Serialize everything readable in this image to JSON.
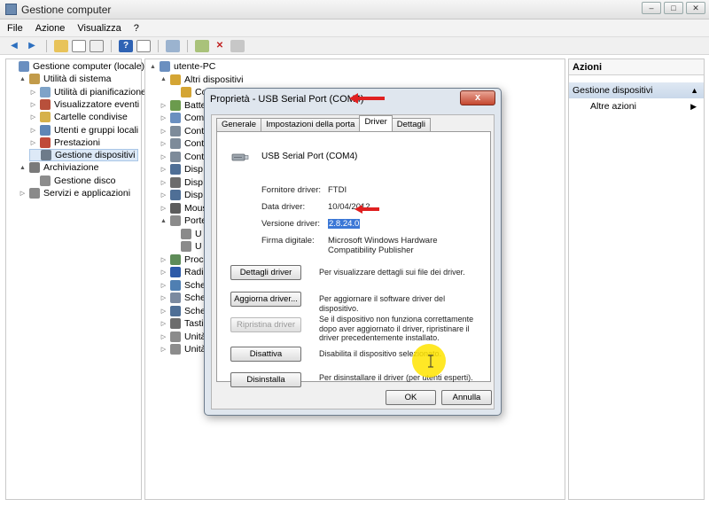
{
  "window": {
    "title": "Gestione computer",
    "controls": [
      "–",
      "□",
      "✕"
    ]
  },
  "menu": [
    "File",
    "Azione",
    "Visualizza",
    "?"
  ],
  "left_tree": [
    {
      "label": "Gestione computer (locale)",
      "level": 0,
      "expander": "",
      "icon": "computer-icon",
      "color": "#6a8fc0"
    },
    {
      "label": "Utilità di sistema",
      "level": 1,
      "expander": "▲",
      "icon": "tools-icon",
      "color": "#c29b4a"
    },
    {
      "label": "Utilità di pianificazione",
      "level": 2,
      "expander": "▷",
      "icon": "clock-icon",
      "color": "#7ea3c8"
    },
    {
      "label": "Visualizzatore eventi",
      "level": 2,
      "expander": "▷",
      "icon": "event-log-icon",
      "color": "#b8503b"
    },
    {
      "label": "Cartelle condivise",
      "level": 2,
      "expander": "▷",
      "icon": "shared-folder-icon",
      "color": "#d6b14a"
    },
    {
      "label": "Utenti e gruppi locali",
      "level": 2,
      "expander": "▷",
      "icon": "users-icon",
      "color": "#5e86b6"
    },
    {
      "label": "Prestazioni",
      "level": 2,
      "expander": "▷",
      "icon": "performance-icon",
      "color": "#c04a3a"
    },
    {
      "label": "Gestione dispositivi",
      "level": 2,
      "expander": "",
      "icon": "device-manager-icon",
      "color": "#6d7b8a",
      "selected": true
    },
    {
      "label": "Archiviazione",
      "level": 1,
      "expander": "▲",
      "icon": "storage-icon",
      "color": "#7a7a7a"
    },
    {
      "label": "Gestione disco",
      "level": 2,
      "expander": "",
      "icon": "disk-icon",
      "color": "#8c8c8c"
    },
    {
      "label": "Servizi e applicazioni",
      "level": 1,
      "expander": "▷",
      "icon": "services-icon",
      "color": "#8a8a8a"
    }
  ],
  "device_tree": [
    {
      "label": "utente-PC",
      "level": 0,
      "expander": "▲",
      "icon": "computer-icon",
      "color": "#6a8fc0"
    },
    {
      "label": "Altri dispositivi",
      "level": 1,
      "expander": "▲",
      "icon": "unknown-device-icon",
      "color": "#d4a534"
    },
    {
      "label": "Controller di...",
      "level": 2,
      "expander": "",
      "icon": "warning-device-icon",
      "color": "#d4a534"
    },
    {
      "label": "Batte",
      "level": 1,
      "expander": "▷",
      "icon": "battery-icon",
      "color": "#6b9b4d"
    },
    {
      "label": "Com",
      "level": 1,
      "expander": "▷",
      "icon": "computer-icon",
      "color": "#6a8fc0"
    },
    {
      "label": "Cont",
      "level": 1,
      "expander": "▷",
      "icon": "controller-icon",
      "color": "#7d8b9a"
    },
    {
      "label": "Cont",
      "level": 1,
      "expander": "▷",
      "icon": "controller-icon",
      "color": "#7d8b9a"
    },
    {
      "label": "Cont",
      "level": 1,
      "expander": "▷",
      "icon": "controller-icon",
      "color": "#7d8b9a"
    },
    {
      "label": "Disp",
      "level": 1,
      "expander": "▷",
      "icon": "display-icon",
      "color": "#4f6f96"
    },
    {
      "label": "Disp",
      "level": 1,
      "expander": "▷",
      "icon": "device-icon",
      "color": "#6c6c6c"
    },
    {
      "label": "Disp",
      "level": 1,
      "expander": "▷",
      "icon": "monitor-icon",
      "color": "#4f6f96"
    },
    {
      "label": "Mous",
      "level": 1,
      "expander": "▷",
      "icon": "mouse-icon",
      "color": "#5c5c5c"
    },
    {
      "label": "Porte",
      "level": 1,
      "expander": "▲",
      "icon": "port-icon",
      "color": "#8b8b8b"
    },
    {
      "label": "U",
      "level": 2,
      "expander": "",
      "icon": "port-icon",
      "color": "#8b8b8b"
    },
    {
      "label": "U",
      "level": 2,
      "expander": "",
      "icon": "port-icon",
      "color": "#8b8b8b"
    },
    {
      "label": "Proc",
      "level": 1,
      "expander": "▷",
      "icon": "processor-icon",
      "color": "#5e8c58"
    },
    {
      "label": "Radi",
      "level": 1,
      "expander": "▷",
      "icon": "bluetooth-icon",
      "color": "#2d5aa8"
    },
    {
      "label": "Sche",
      "level": 1,
      "expander": "▷",
      "icon": "network-icon",
      "color": "#4f7fb2"
    },
    {
      "label": "Sche",
      "level": 1,
      "expander": "▷",
      "icon": "sound-icon",
      "color": "#7b8aa0"
    },
    {
      "label": "Sche",
      "level": 1,
      "expander": "▷",
      "icon": "video-icon",
      "color": "#4f6f96"
    },
    {
      "label": "Tasti",
      "level": 1,
      "expander": "▷",
      "icon": "keyboard-icon",
      "color": "#6c6c6c"
    },
    {
      "label": "Unità",
      "level": 1,
      "expander": "▷",
      "icon": "drive-icon",
      "color": "#8c8c8c"
    },
    {
      "label": "Unità",
      "level": 1,
      "expander": "▷",
      "icon": "dvd-icon",
      "color": "#8c8c8c"
    }
  ],
  "actions": {
    "header": "Azioni",
    "section": "Gestione dispositivi",
    "section_arrow": "▲",
    "items": [
      {
        "label": "Altre azioni",
        "arrow": "▶"
      }
    ]
  },
  "dialog": {
    "title": "Proprietà - USB Serial Port (COM4)",
    "close": "x",
    "tabs": [
      "Generale",
      "Impostazioni della porta",
      "Driver",
      "Dettagli"
    ],
    "active_tab": "Driver",
    "device_name": "USB Serial Port (COM4)",
    "properties": [
      {
        "label": "Fornitore driver:",
        "value": "FTDI"
      },
      {
        "label": "Data driver:",
        "value": "10/04/2012"
      },
      {
        "label": "Versione driver:",
        "value": "2.8.24.0",
        "highlighted": true
      },
      {
        "label": "Firma digitale:",
        "value": "Microsoft Windows Hardware Compatibility Publisher"
      }
    ],
    "buttons": [
      {
        "label": "Dettagli driver",
        "desc": "Per visualizzare dettagli sui file dei driver.",
        "enabled": true
      },
      {
        "label": "Aggiorna driver...",
        "desc": "Per aggiornare il software driver del dispositivo.",
        "enabled": true
      },
      {
        "label": "Ripristina driver",
        "desc": "Se il dispositivo non funziona correttamente dopo aver aggiornato il driver, ripristinare il driver precedentemente installato.",
        "enabled": false
      },
      {
        "label": "Disattiva",
        "desc": "Disabilita il dispositivo selezionato.",
        "enabled": true
      },
      {
        "label": "Disinstalla",
        "desc": "Per disinstallare il driver (per utenti esperti).",
        "enabled": true
      }
    ],
    "ok": "OK",
    "cancel": "Annulla"
  },
  "colors": {
    "annotation_arrow": "#e02020",
    "cursor_highlight": "#ffe400",
    "selection": "#3b77d6"
  }
}
